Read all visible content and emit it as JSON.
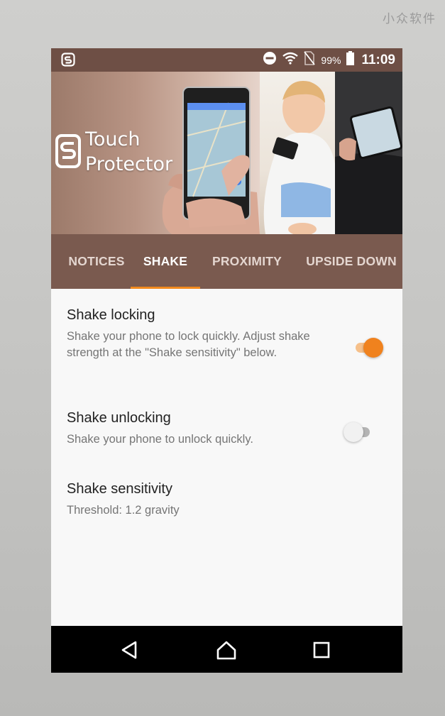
{
  "watermark": "小众软件",
  "status_bar": {
    "battery_percent": "99%",
    "time": "11:09",
    "icons": [
      "touch-protector-icon",
      "do-not-disturb-icon",
      "wifi-icon",
      "no-sim-icon",
      "battery-icon"
    ]
  },
  "banner": {
    "title_line1": "Touch",
    "title_line2": "Protector"
  },
  "tabs": [
    {
      "label": "NOTICES",
      "active": false
    },
    {
      "label": "SHAKE",
      "active": true
    },
    {
      "label": "PROXIMITY",
      "active": false
    },
    {
      "label": "UPSIDE DOWN",
      "active": false
    }
  ],
  "settings": [
    {
      "title": "Shake locking",
      "summary": "Shake your phone to lock quickly. Adjust shake strength at the \"Shake sensitivity\" below.",
      "switch_on": true
    },
    {
      "title": "Shake unlocking",
      "summary": "Shake your phone to unlock quickly.",
      "switch_on": false
    },
    {
      "title": "Shake sensitivity",
      "summary": "Threshold: 1.2 gravity"
    }
  ],
  "colors": {
    "primary": "#6e4f45",
    "tab_bar": "#7a5a4f",
    "accent": "#f0821e"
  },
  "nav_bar": {
    "icons": [
      "back-icon",
      "home-icon",
      "recents-icon"
    ]
  }
}
